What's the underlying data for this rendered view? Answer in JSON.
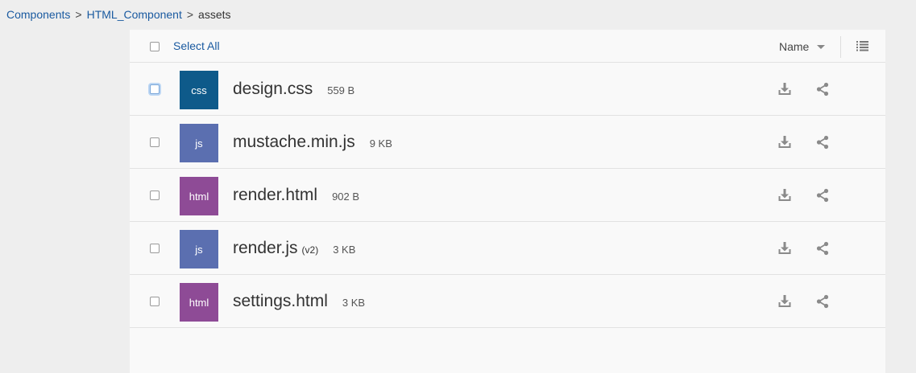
{
  "breadcrumb": {
    "items": [
      "Components",
      "HTML_Component"
    ],
    "separator": ">",
    "current": "assets"
  },
  "header": {
    "select_all_label": "Select All",
    "sort_label": "Name",
    "list_view_icon": "list-view-icon"
  },
  "files": [
    {
      "type_label": "css",
      "name": "design.css",
      "version": "",
      "size": "559 B",
      "color": "#0e5a8a",
      "focused": true
    },
    {
      "type_label": "js",
      "name": "mustache.min.js",
      "version": "",
      "size": "9 KB",
      "color": "#5b6fb0"
    },
    {
      "type_label": "html",
      "name": "render.html",
      "version": "",
      "size": "902 B",
      "color": "#8e4b96"
    },
    {
      "type_label": "js",
      "name": "render.js",
      "version": "(v2)",
      "size": "3 KB",
      "color": "#5b6fb0"
    },
    {
      "type_label": "html",
      "name": "settings.html",
      "version": "",
      "size": "3 KB",
      "color": "#8e4b96"
    }
  ],
  "colors": {
    "link": "#1a5aa0",
    "icon_gray": "#888888"
  },
  "icons": {
    "download": "download-icon",
    "share": "share-icon"
  }
}
